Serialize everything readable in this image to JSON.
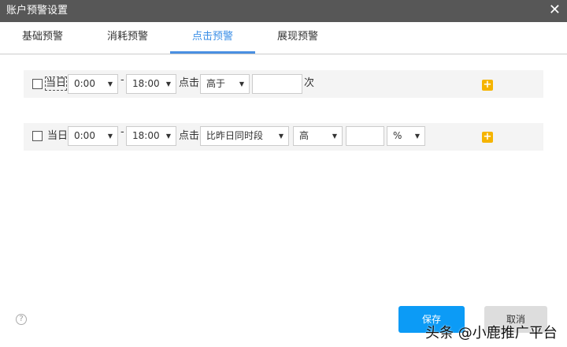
{
  "window": {
    "title": "账户预警设置",
    "close_icon": "close-icon"
  },
  "tabs": [
    {
      "label": "基础预警"
    },
    {
      "label": "消耗预警"
    },
    {
      "label": "点击预警",
      "active": true
    },
    {
      "label": "展现预警"
    }
  ],
  "rows": [
    {
      "checked": false,
      "day_label": "当日",
      "start": "0:00",
      "dash": "-",
      "end": "18:00",
      "metric_label": "点击",
      "compare": "高于",
      "value": "",
      "unit": "次"
    },
    {
      "checked": false,
      "day_label": "当日",
      "start": "0:00",
      "dash": "-",
      "end": "18:00",
      "metric_label": "点击",
      "compare": "比昨日同时段",
      "direction": "高",
      "value": "",
      "unit": "%"
    }
  ],
  "footer": {
    "help": "?",
    "save": "保存",
    "cancel": "取消"
  },
  "watermark": "头条 @小鹿推广平台",
  "colors": {
    "accent": "#4a90e2",
    "save": "#0c9bf6",
    "plus": "#f5b400",
    "titlebar": "#575757"
  }
}
